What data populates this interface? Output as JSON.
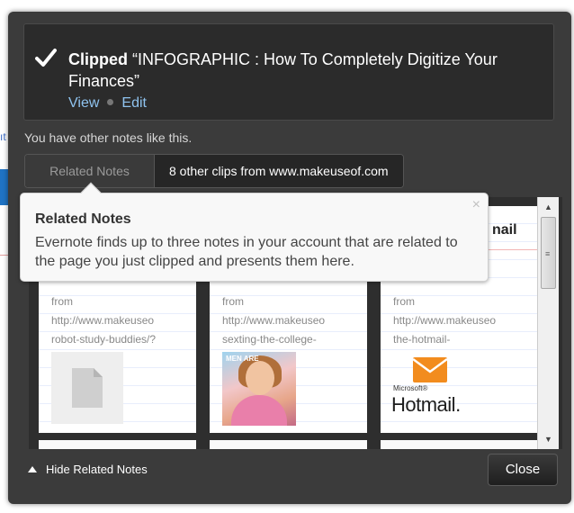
{
  "page_bg": {
    "fragment": "ıt"
  },
  "clipped": {
    "label": "Clipped",
    "title": "“INFOGRAPHIC : How To Completely Digitize Your Finances”",
    "view": "View",
    "edit": "Edit"
  },
  "other_notes_text": "You have other notes like this.",
  "tabs": [
    {
      "label": "Related Notes"
    },
    {
      "label": "8 other clips from www.makeuseof.com"
    }
  ],
  "cards": [
    {
      "from": "from",
      "url1": "http://www.makeuseo",
      "url2": "robot-study-buddies/?"
    },
    {
      "from": "from",
      "url1": "http://www.makeuseo",
      "url2": "sexting-the-college-"
    },
    {
      "title": "nail",
      "from": "from",
      "url1": "http://www.makeuseo",
      "url2": "the-hotmail-"
    }
  ],
  "hotmail_logo": {
    "microsoft": "Microsoft®",
    "word": "Hotmail."
  },
  "thumbnail_caption": "MEN ARE",
  "tooltip": {
    "title": "Related Notes",
    "body": "Evernote finds up to three notes in your account that are related to the page you just clipped and presents them here.",
    "close": "×"
  },
  "scrollbar": {
    "up": "▲",
    "down": "▼",
    "grip": "≡"
  },
  "footer": {
    "hide_related": "Hide Related Notes",
    "close": "Close"
  },
  "colors": {
    "popup_bg": "#3b3b3b",
    "link": "#8fc3ef",
    "hotmail_orange": "#f28c1e"
  }
}
